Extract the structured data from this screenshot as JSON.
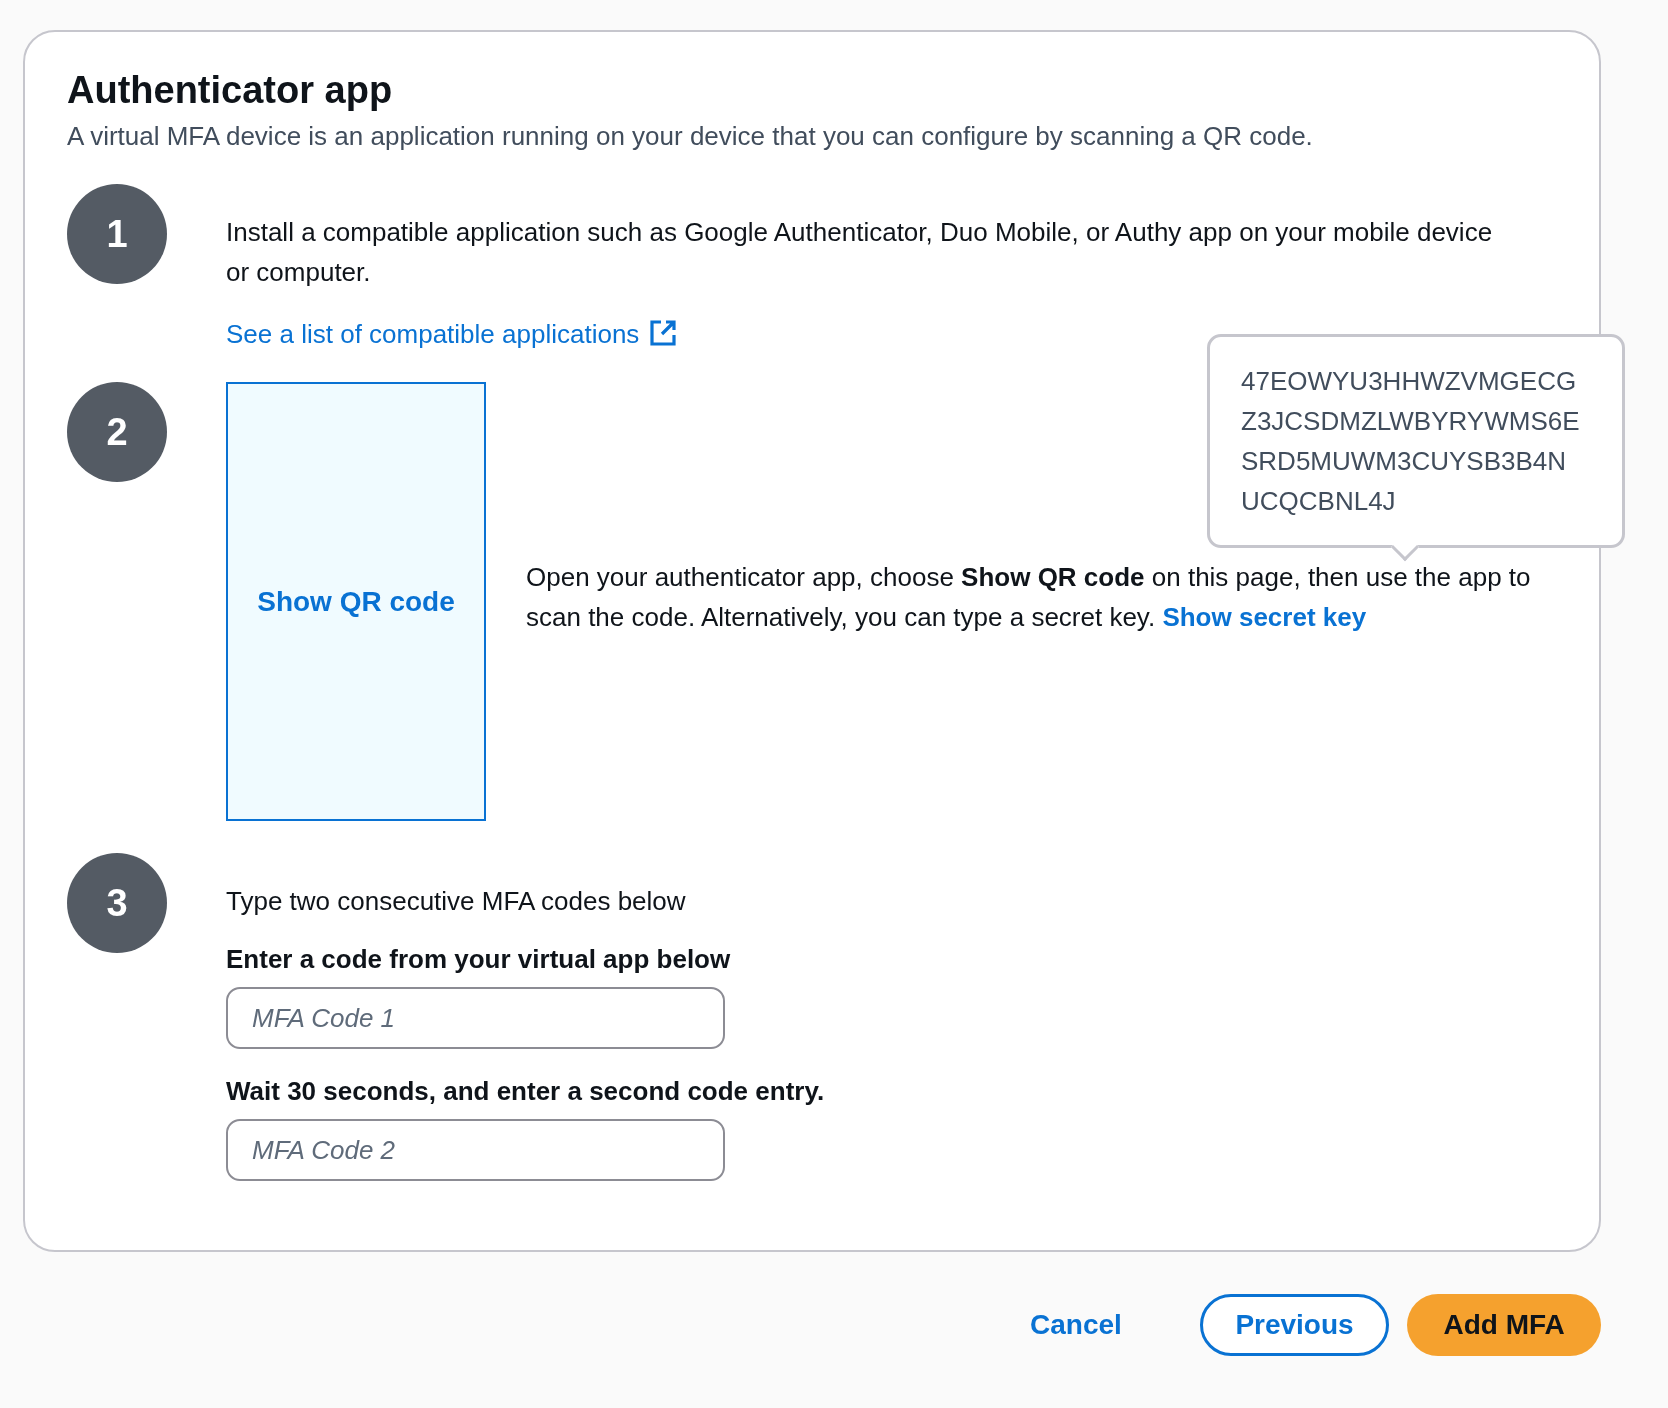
{
  "panel": {
    "title": "Authenticator app",
    "description": "A virtual MFA device is an application running on your device that you can configure by scanning a QR code."
  },
  "steps": [
    {
      "number": "1",
      "kind": "install",
      "text": "Install a compatible application such as Google Authenticator, Duo Mobile, or Authy app on your mobile device or computer.",
      "link": "See a list of compatible applications"
    },
    {
      "number": "2",
      "kind": "qr",
      "qr_button": "Show QR code",
      "text": "Open your authenticator app, choose **Show QR code** on this page, then use the app to scan the code. Alternatively, you can type a secret key.",
      "link": "Show secret key",
      "secret_key": [
        "47EOWYU3HHWZVMGECG",
        "Z3JCSDMZLWBYRYWMS6E",
        "SRD5MUWM3CUYSB3B4N",
        "UCQCBNL4J"
      ]
    },
    {
      "number": "3",
      "kind": "codes",
      "text": "Type two consecutive MFA codes below",
      "fields": [
        {
          "label": "Enter a code from your virtual app below",
          "placeholder": "MFA Code 1"
        },
        {
          "label": "Wait 30 seconds, and enter a second code entry.",
          "placeholder": "MFA Code 2"
        }
      ]
    }
  ],
  "buttons": [
    {
      "label": "Cancel",
      "kind": "link"
    },
    {
      "label": "Previous",
      "kind": "outline"
    },
    {
      "label": "Add MFA",
      "kind": "primary"
    }
  ]
}
